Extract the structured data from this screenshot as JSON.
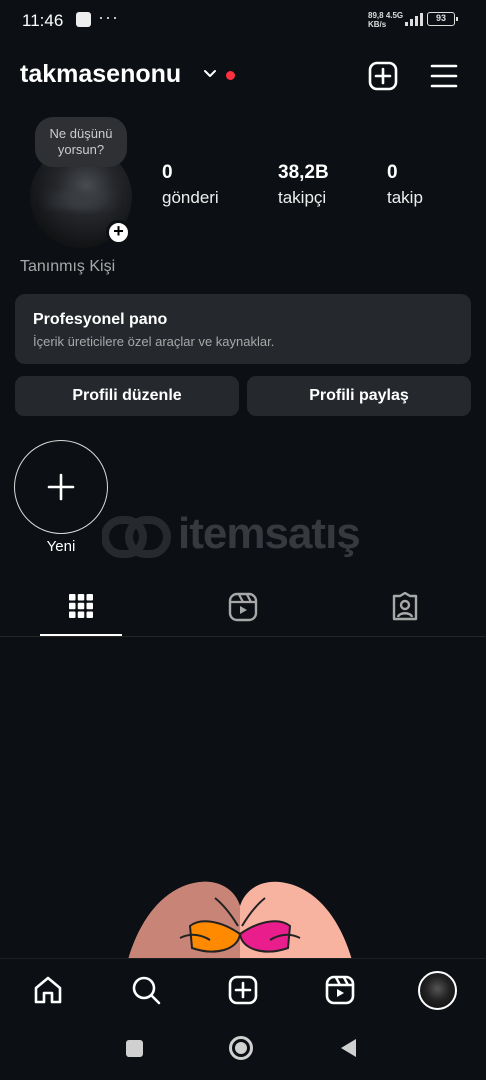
{
  "status_bar": {
    "time": "11:46",
    "dots": "···",
    "net_speed": "89,8",
    "net_unit": "KB/s",
    "net_type": "4.5G",
    "battery": "93"
  },
  "header": {
    "username": "takmasenonu",
    "accent_color": "#ff3040"
  },
  "profile": {
    "note_bubble": "Ne düşünü yorsun?",
    "stats": [
      {
        "value": "0",
        "label": "gönderi"
      },
      {
        "value": "38,2B",
        "label": "takipçi"
      },
      {
        "value": "0",
        "label": "takip"
      }
    ],
    "category": "Tanınmış Kişi"
  },
  "pro_panel": {
    "title": "Profesyonel pano",
    "subtitle": "İçerik üreticilere özel araçlar ve kaynaklar."
  },
  "buttons": {
    "edit": "Profili düzenle",
    "share": "Profili paylaş"
  },
  "highlights": {
    "new_label": "Yeni"
  },
  "watermark": {
    "text": "itemsatış"
  },
  "tabs": [
    {
      "icon": "grid-icon",
      "active": true
    },
    {
      "icon": "reels-icon",
      "active": false
    },
    {
      "icon": "tagged-icon",
      "active": false
    }
  ],
  "bottom_nav": [
    "home-icon",
    "search-icon",
    "create-icon",
    "reels-icon",
    "profile-avatar"
  ],
  "system_nav": [
    "recents-button",
    "home-button",
    "back-button"
  ]
}
